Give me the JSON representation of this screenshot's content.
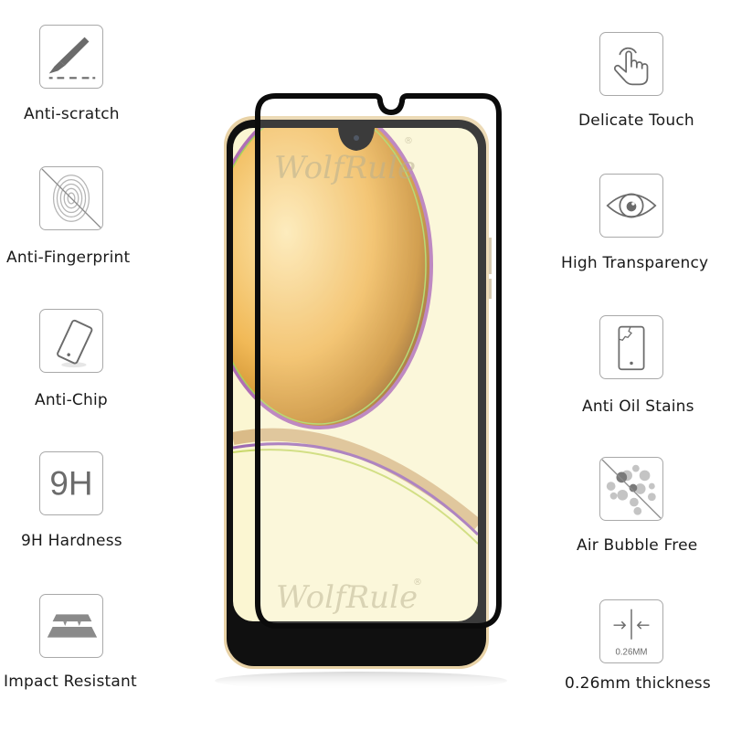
{
  "features_left": [
    {
      "label": "Anti-scratch",
      "icon": "scalpel-scratch-icon"
    },
    {
      "label": "Anti-Fingerprint",
      "icon": "fingerprint-crossed-icon"
    },
    {
      "label": "Anti-Chip",
      "icon": "tilted-phone-icon"
    },
    {
      "label": "9H Hardness",
      "icon": "9h-icon",
      "icon_text": "9H"
    },
    {
      "label": "Impact Resistant",
      "icon": "layered-plates-icon"
    }
  ],
  "features_right": [
    {
      "label": "Delicate Touch",
      "icon": "touch-hand-icon"
    },
    {
      "label": "High Transparency",
      "icon": "eye-icon"
    },
    {
      "label": "Anti Oil Stains",
      "icon": "cracked-phone-icon"
    },
    {
      "label": "Air Bubble Free",
      "icon": "bubbles-crossed-icon"
    },
    {
      "label": "0.26mm thickness",
      "icon": "thickness-arrows-icon",
      "icon_text": "0.26MM"
    }
  ],
  "product": {
    "watermark_top": "WolfRule",
    "watermark_bottom": "WolfRule",
    "registered_mark": "®"
  },
  "colors": {
    "icon_border": "#a9a9a9",
    "icon_fill": "#6b6b6b",
    "text": "#1a1a1a",
    "screen_bg": "#fbf6d2",
    "orb": "#e8a94a",
    "film_edge": "#0b0b0b"
  }
}
